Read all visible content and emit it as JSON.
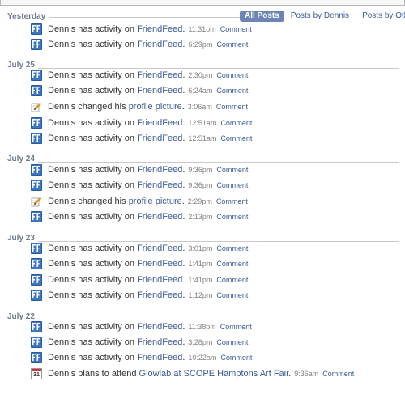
{
  "filter_tabs": {
    "all_posts": "All Posts",
    "posts_by_dennis": "Posts by Dennis",
    "posts_by_others": "Posts by Others"
  },
  "days": [
    {
      "label": "Yesterday",
      "stories": [
        {
          "actor": "Dennis",
          "verb": "has activity on",
          "target": "FriendFeed",
          "punct": ".",
          "time": "11:31pm",
          "comment": "Comment",
          "icon": "friendfeed-icon"
        },
        {
          "actor": "Dennis",
          "verb": "has activity on",
          "target": "FriendFeed",
          "punct": ".",
          "time": "6:29pm",
          "comment": "Comment",
          "icon": "friendfeed-icon"
        }
      ]
    },
    {
      "label": "July 25",
      "stories": [
        {
          "actor": "Dennis",
          "verb": "has activity on",
          "target": "FriendFeed",
          "punct": ".",
          "time": "2:30pm",
          "comment": "Comment",
          "icon": "friendfeed-icon"
        },
        {
          "actor": "Dennis",
          "verb": "has activity on",
          "target": "FriendFeed",
          "punct": ".",
          "time": "6:24am",
          "comment": "Comment",
          "icon": "friendfeed-icon"
        },
        {
          "actor": "Dennis",
          "verb": "changed his",
          "target": "profile picture",
          "punct": ".",
          "time": "3:06am",
          "comment": "Comment",
          "icon": "pencil-icon"
        },
        {
          "actor": "Dennis",
          "verb": "has activity on",
          "target": "FriendFeed",
          "punct": ".",
          "time": "12:51am",
          "comment": "Comment",
          "icon": "friendfeed-icon"
        },
        {
          "actor": "Dennis",
          "verb": "has activity on",
          "target": "FriendFeed",
          "punct": ".",
          "time": "12:51am",
          "comment": "Comment",
          "icon": "friendfeed-icon"
        }
      ]
    },
    {
      "label": "July 24",
      "stories": [
        {
          "actor": "Dennis",
          "verb": "has activity on",
          "target": "FriendFeed",
          "punct": ".",
          "time": "9:36pm",
          "comment": "Comment",
          "icon": "friendfeed-icon"
        },
        {
          "actor": "Dennis",
          "verb": "has activity on",
          "target": "FriendFeed",
          "punct": ".",
          "time": "9:36pm",
          "comment": "Comment",
          "icon": "friendfeed-icon"
        },
        {
          "actor": "Dennis",
          "verb": "changed his",
          "target": "profile picture",
          "punct": ".",
          "time": "2:29pm",
          "comment": "Comment",
          "icon": "pencil-icon"
        },
        {
          "actor": "Dennis",
          "verb": "has activity on",
          "target": "FriendFeed",
          "punct": ".",
          "time": "2:13pm",
          "comment": "Comment",
          "icon": "friendfeed-icon"
        }
      ]
    },
    {
      "label": "July 23",
      "stories": [
        {
          "actor": "Dennis",
          "verb": "has activity on",
          "target": "FriendFeed",
          "punct": ".",
          "time": "3:01pm",
          "comment": "Comment",
          "icon": "friendfeed-icon"
        },
        {
          "actor": "Dennis",
          "verb": "has activity on",
          "target": "FriendFeed",
          "punct": ".",
          "time": "1:41pm",
          "comment": "Comment",
          "icon": "friendfeed-icon"
        },
        {
          "actor": "Dennis",
          "verb": "has activity on",
          "target": "FriendFeed",
          "punct": ".",
          "time": "1:41pm",
          "comment": "Comment",
          "icon": "friendfeed-icon"
        },
        {
          "actor": "Dennis",
          "verb": "has activity on",
          "target": "FriendFeed",
          "punct": ".",
          "time": "1:12pm",
          "comment": "Comment",
          "icon": "friendfeed-icon"
        }
      ]
    },
    {
      "label": "July 22",
      "stories": [
        {
          "actor": "Dennis",
          "verb": "has activity on",
          "target": "FriendFeed",
          "punct": ".",
          "time": "11:38pm",
          "comment": "Comment",
          "icon": "friendfeed-icon"
        },
        {
          "actor": "Dennis",
          "verb": "has activity on",
          "target": "FriendFeed",
          "punct": ".",
          "time": "3:28pm",
          "comment": "Comment",
          "icon": "friendfeed-icon"
        },
        {
          "actor": "Dennis",
          "verb": "has activity on",
          "target": "FriendFeed",
          "punct": ".",
          "time": "10:22am",
          "comment": "Comment",
          "icon": "friendfeed-icon"
        },
        {
          "actor": "Dennis",
          "verb": "plans to attend",
          "target": "Glowlab at SCOPE Hamptons Art Fair",
          "punct": ".",
          "time": "9:36am",
          "comment": "Comment",
          "icon": "calendar-icon",
          "icon_text": "31"
        }
      ]
    }
  ],
  "colors": {
    "link": "#3b5998",
    "active_tab": "#6d84b4",
    "header_text": "#6d7a8c",
    "timestamp": "#808080"
  }
}
